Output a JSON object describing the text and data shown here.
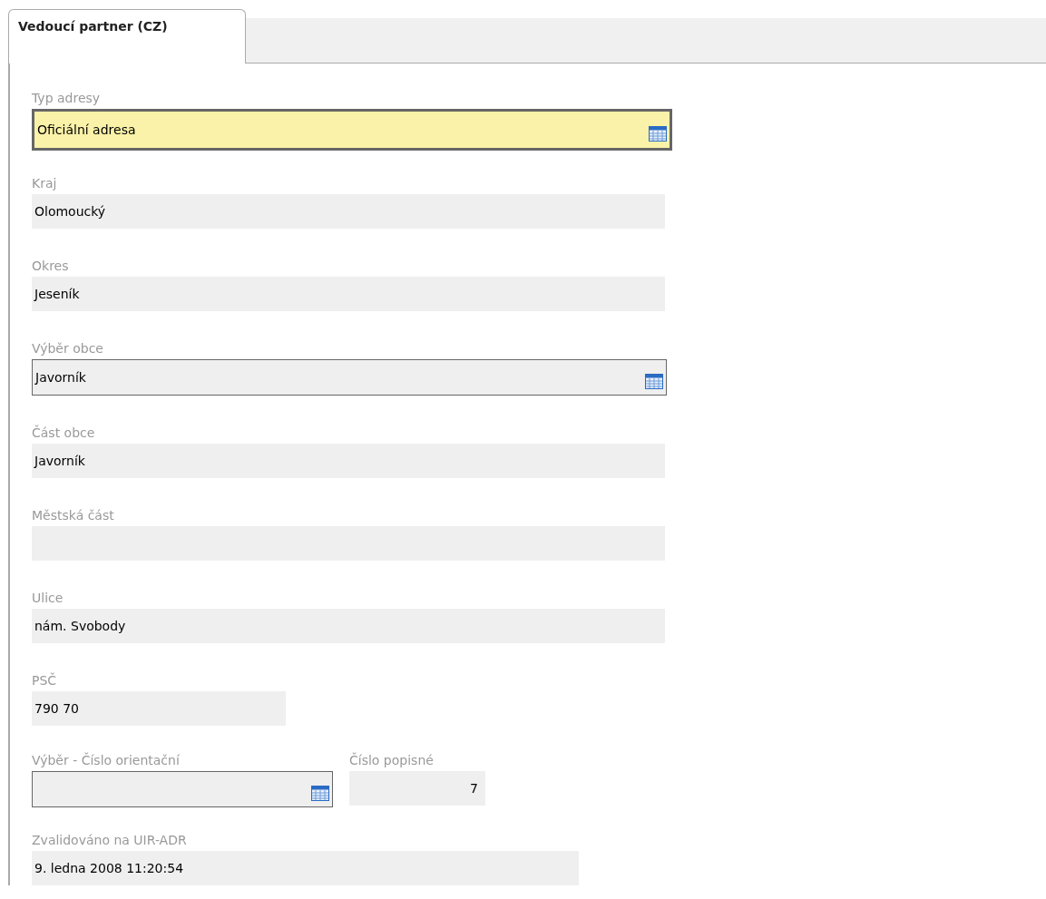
{
  "tabs": [
    {
      "label": "Vedoucí partner (CZ)",
      "selected": true
    }
  ],
  "rows": [
    [
      {
        "label": "Typ adresy",
        "kind": "picker",
        "value": "Oficiální adresa",
        "focused": true
      }
    ],
    [
      {
        "label": "Kraj",
        "kind": "text",
        "value": "Olomoucký"
      }
    ],
    [
      {
        "label": "Okres",
        "kind": "text",
        "value": "Jeseník"
      }
    ],
    [
      {
        "label": "Výběr obce",
        "kind": "picker",
        "value": "Javorník",
        "focused": false
      }
    ],
    [
      {
        "label": "Část obce",
        "kind": "text",
        "value": "Javorník"
      }
    ],
    [
      {
        "label": "Městská část",
        "kind": "text"
      }
    ],
    [
      {
        "label": "Ulice",
        "kind": "text",
        "value": "nám. Svobody"
      }
    ],
    [
      {
        "label": "PSČ",
        "kind": "text",
        "value": "790 70"
      }
    ],
    [
      {
        "label": "Výběr - Číslo orientační",
        "kind": "picker",
        "focused": false
      },
      {
        "label": "Číslo popisné",
        "kind": "number",
        "value": "7"
      }
    ],
    [
      {
        "label": "Zvalidováno na UIR-ADR",
        "kind": "text",
        "value": "9. ledna 2008 11:20:54"
      }
    ]
  ]
}
